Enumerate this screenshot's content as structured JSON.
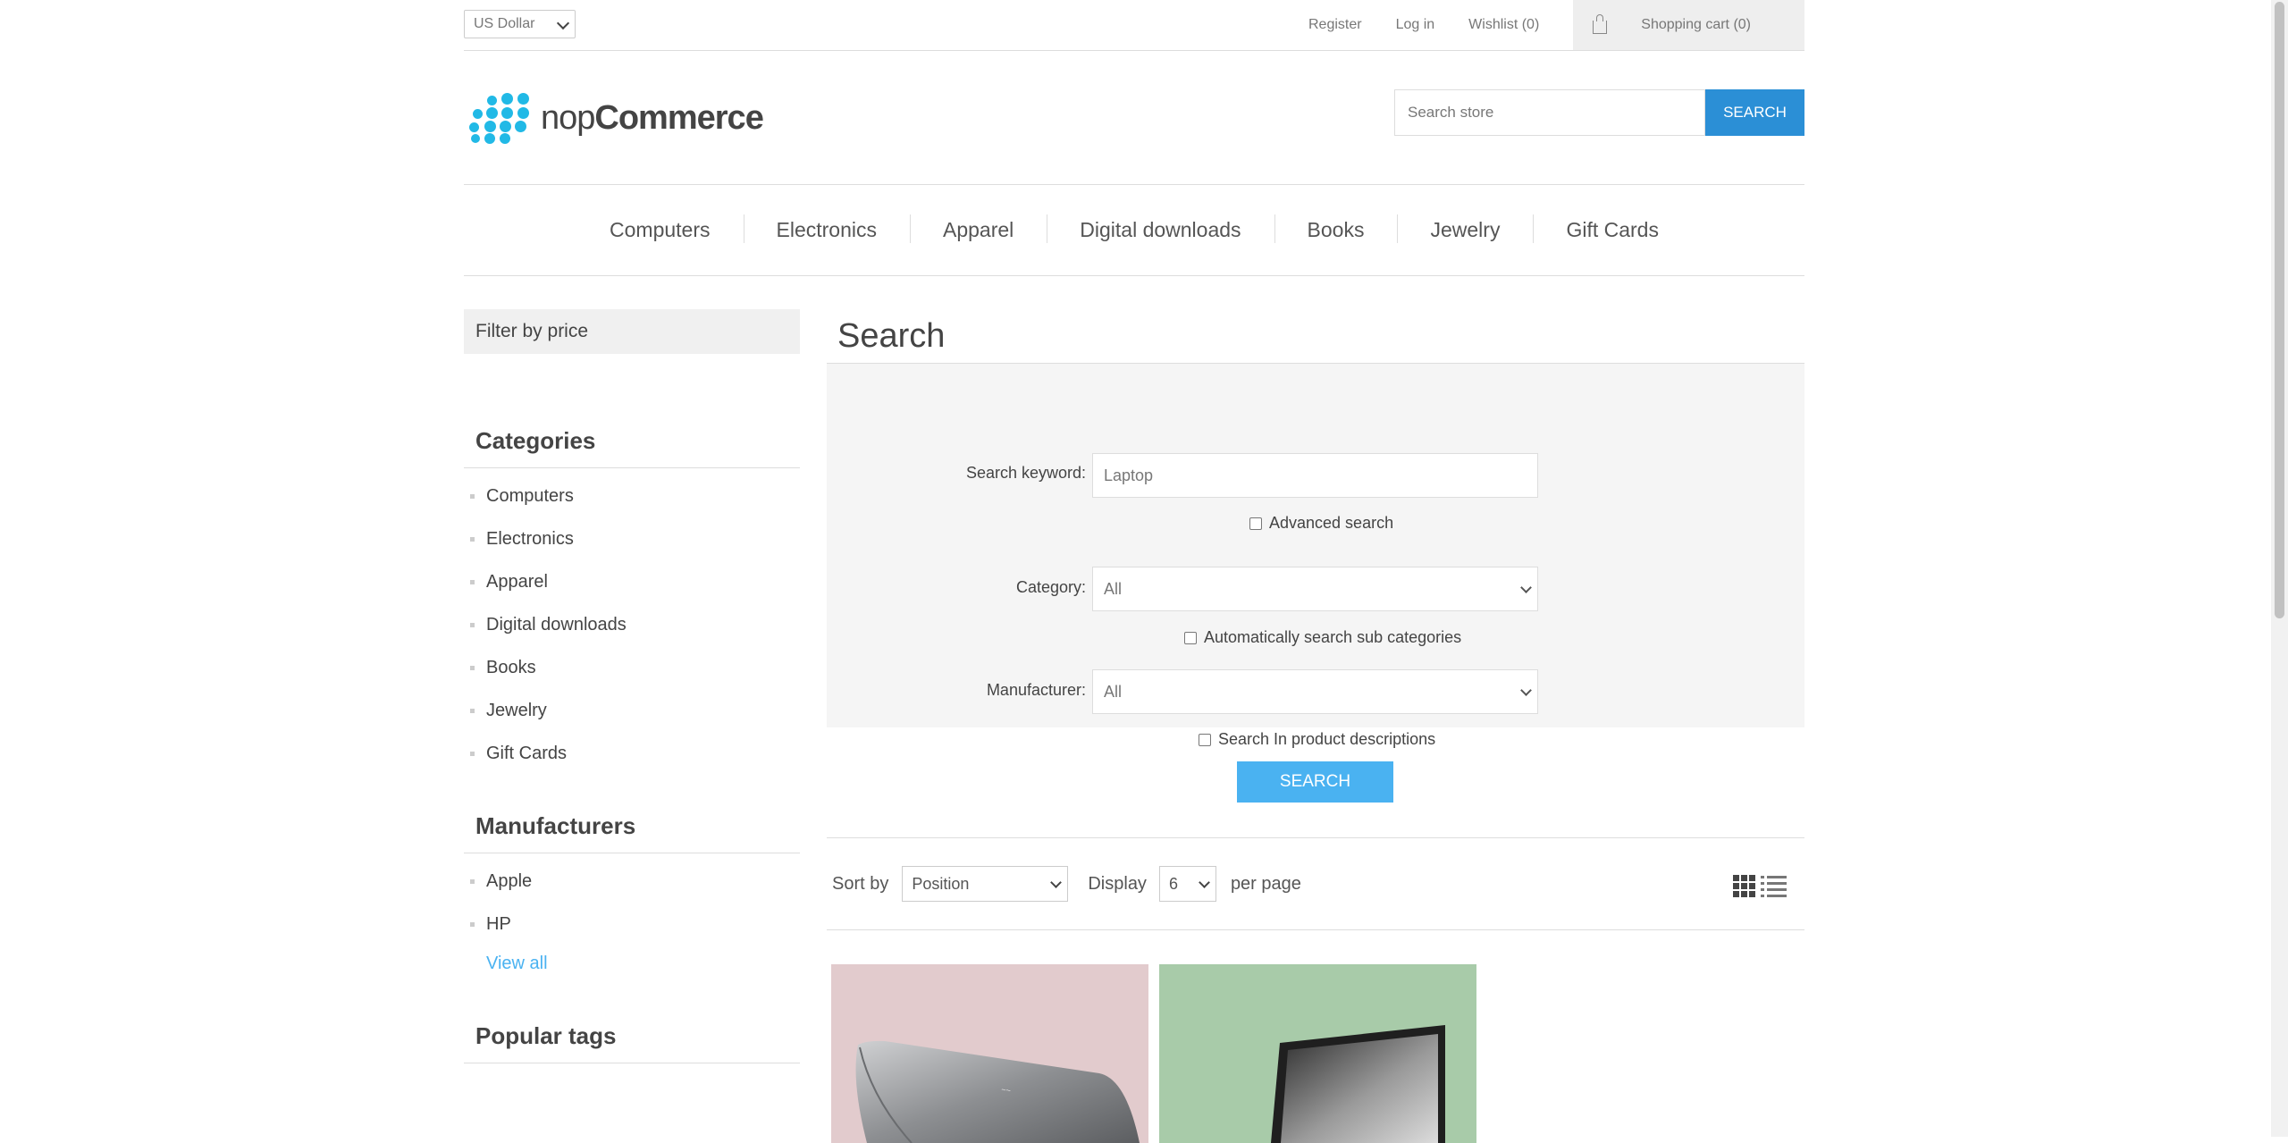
{
  "header": {
    "currency": "US Dollar",
    "links": {
      "register": "Register",
      "login": "Log in",
      "wishlist": "Wishlist (0)",
      "cart": "Shopping cart (0)"
    },
    "logo": {
      "light": "nop",
      "bold": "Commerce"
    },
    "search": {
      "placeholder": "Search store",
      "button": "SEARCH"
    }
  },
  "nav": [
    "Computers",
    "Electronics",
    "Apparel",
    "Digital downloads",
    "Books",
    "Jewelry",
    "Gift Cards"
  ],
  "sidebar": {
    "filter_title": "Filter by price",
    "categories_title": "Categories",
    "categories": [
      "Computers",
      "Electronics",
      "Apparel",
      "Digital downloads",
      "Books",
      "Jewelry",
      "Gift Cards"
    ],
    "manufacturers_title": "Manufacturers",
    "manufacturers": [
      "Apple",
      "HP"
    ],
    "view_all": "View all",
    "popular_tags_title": "Popular tags"
  },
  "search_page": {
    "title": "Search",
    "keyword_label": "Search keyword:",
    "keyword_value": "Laptop",
    "advanced_label": "Advanced search",
    "category_label": "Category:",
    "category_value": "All",
    "subcat_label": "Automatically search sub categories",
    "manufacturer_label": "Manufacturer:",
    "manufacturer_value": "All",
    "descriptions_label": "Search In product descriptions",
    "button": "SEARCH"
  },
  "sortbar": {
    "sort_label": "Sort by",
    "sort_value": "Position",
    "display_label": "Display",
    "display_value": "6",
    "per_page": "per page"
  },
  "colors": {
    "accent": "#4ab2f1",
    "header_search_button": "#2b8fd6",
    "product1_bg": "#e2cbcd",
    "product2_bg": "#a8cba9"
  }
}
